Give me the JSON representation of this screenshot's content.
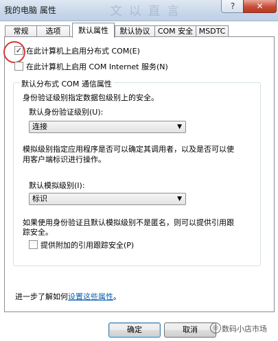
{
  "window": {
    "title": "我的电脑 属性",
    "ghost_text": "文 以 直 言",
    "help_glyph": "?",
    "close_glyph": "✕"
  },
  "tabs": [
    {
      "label": "常规"
    },
    {
      "label": "选项"
    },
    {
      "label": "默认属性",
      "active": true
    },
    {
      "label": "默认协议"
    },
    {
      "label": "COM 安全"
    },
    {
      "label": "MSDTC"
    }
  ],
  "options": {
    "enable_dcom": {
      "label": "在此计算机上启用分布式 COM(E)",
      "checked": true
    },
    "enable_com_internet": {
      "label": "在此计算机上启用 COM Internet 服务(N)",
      "checked": false
    }
  },
  "group": {
    "title": "默认分布式 COM 通信属性",
    "auth_desc": "身份验证级别指定数据包级别上的安全。",
    "auth_level_label": "默认身份验证级别(U):",
    "auth_level_value": "连接",
    "impersonation_desc_1": "模拟级别指定应用程序是否可以确定其调用者，以及是否可以使",
    "impersonation_desc_2": "用客户端标识进行操作。",
    "impersonation_label": "默认模拟级别(I):",
    "impersonation_value": "标识",
    "tracking_desc_1": "如果使用身份验证且默认模拟级别不是匿名，则可以提供引用跟",
    "tracking_desc_2": "踪安全。",
    "tracking_checkbox": {
      "label": "提供附加的引用跟踪安全(P)",
      "checked": false
    }
  },
  "learn_more": {
    "prefix": "进一步了解如何",
    "link": "设置这些属性",
    "suffix": "。"
  },
  "buttons": {
    "ok": "确定",
    "cancel": "取消"
  },
  "watermark": {
    "text": "数码小店市场",
    "icon_glyph": "◎"
  }
}
